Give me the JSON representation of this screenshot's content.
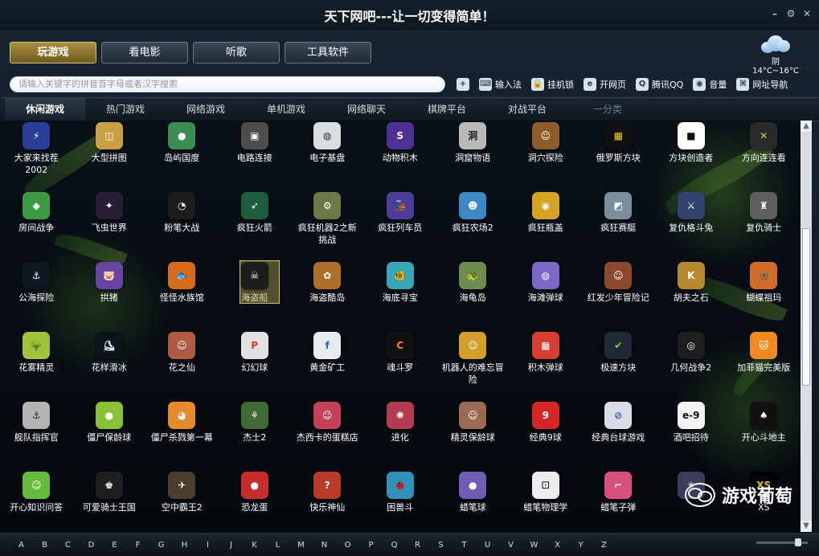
{
  "window": {
    "title": "天下网吧---让一切变得简单！"
  },
  "top_tabs": [
    "玩游戏",
    "看电影",
    "听歌",
    "工具软件"
  ],
  "weather": {
    "condition": "阴",
    "temp": "14°C~16°C"
  },
  "search": {
    "placeholder": "请输入关键字的拼音首字母或者汉字搜索"
  },
  "toolbar": [
    {
      "label": "输入法",
      "icon": "keyboard-icon"
    },
    {
      "label": "挂机锁",
      "icon": "lock-icon"
    },
    {
      "label": "开网页",
      "icon": "browser-icon"
    },
    {
      "label": "腾讯QQ",
      "icon": "qq-icon"
    },
    {
      "label": "音量",
      "icon": "volume-icon"
    },
    {
      "label": "网址导航",
      "icon": "navigation-icon"
    }
  ],
  "categories": [
    "休闲游戏",
    "热门游戏",
    "网络游戏",
    "单机游戏",
    "网络聊天",
    "棋牌平台",
    "对战平台",
    "一分类"
  ],
  "games": [
    [
      "大家来找茬2002",
      "大型拼图",
      "岛屿国度",
      "电路连接",
      "电子基盘",
      "动物积木",
      "洞窟物语",
      "洞穴探险",
      "俄罗斯方块",
      "方块创造者",
      "方向连连看"
    ],
    [
      "房间战争",
      "飞虫世界",
      "粉笔大战",
      "疯狂火箭",
      "疯狂机器2之新挑战",
      "疯狂列车员",
      "疯狂农场2",
      "疯狂瓶盖",
      "疯狂赛艇",
      "复仇格斗兔",
      "复仇骑士"
    ],
    [
      "公海探险",
      "拱猪",
      "怪怪水族馆",
      "海盗船",
      "海盗酷岛",
      "海底寻宝",
      "海龟岛",
      "海滩弹球",
      "红发少年冒险记",
      "胡夫之石",
      "蝴蝶祖玛"
    ],
    [
      "花雾精灵",
      "花样滑冰",
      "花之仙",
      "幻幻球",
      "黄金矿工",
      "魂斗罗",
      "机器人的难忘冒险",
      "积木弹球",
      "极速方块",
      "几何战争2",
      "加菲猫完美版"
    ],
    [
      "舰队指挥官",
      "僵尸保龄球",
      "僵尸杀戮第一幕",
      "杰士2",
      "杰西卡的蛋糕店",
      "进化",
      "精灵保龄球",
      "经典9球",
      "经典台球游戏",
      "酒吧招待",
      "开心斗地主"
    ],
    [
      "开心知识问答",
      "可爱骑士王国",
      "空中霸王2",
      "恐龙蛋",
      "快乐神仙",
      "困兽斗",
      "蜡笔球",
      "蜡笔物理学",
      "蜡笔子弹",
      "",
      "XS"
    ]
  ],
  "selected_game": "海盗船",
  "alphabet": [
    "A",
    "B",
    "C",
    "D",
    "E",
    "F",
    "G",
    "H",
    "I",
    "J",
    "K",
    "L",
    "M",
    "N",
    "O",
    "P",
    "Q",
    "R",
    "S",
    "T",
    "U",
    "V",
    "W",
    "X",
    "Y",
    "Z"
  ],
  "watermark": "游戏葡萄",
  "colors": {
    "accent": "#a98f45",
    "background": "#0b1016"
  }
}
